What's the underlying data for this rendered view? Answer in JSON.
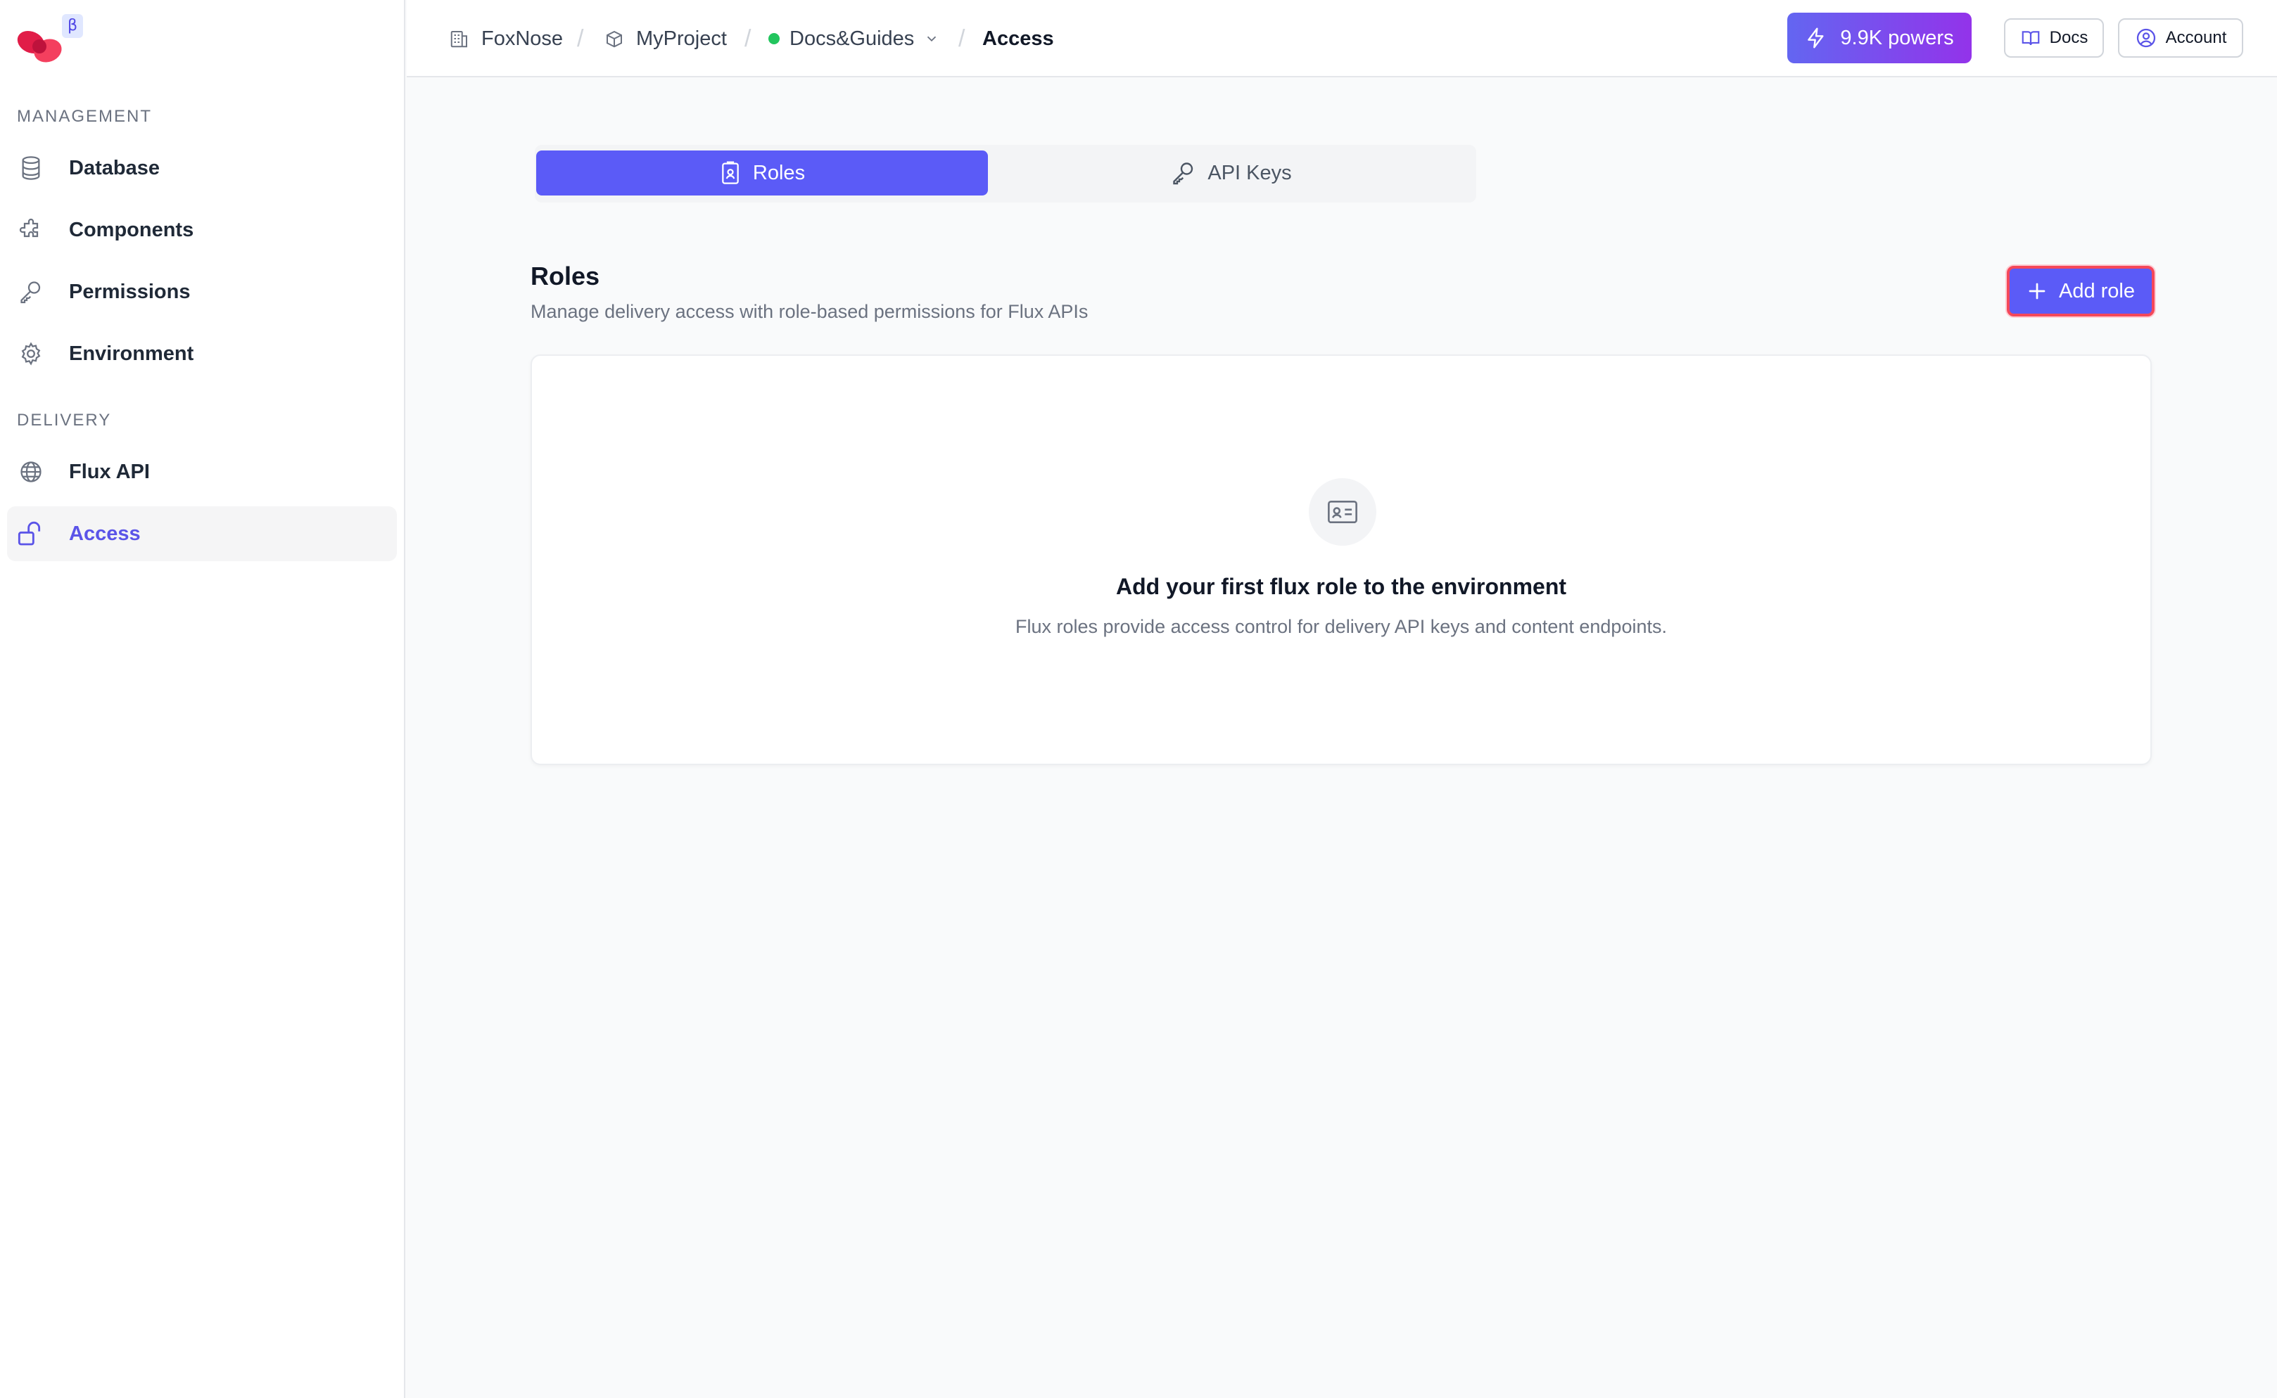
{
  "brand": {
    "beta_badge": "β"
  },
  "sidebar": {
    "management_label": "MANAGEMENT",
    "delivery_label": "DELIVERY",
    "items": [
      {
        "label": "Database",
        "icon": "database-icon"
      },
      {
        "label": "Components",
        "icon": "puzzle-icon"
      },
      {
        "label": "Permissions",
        "icon": "key-icon"
      },
      {
        "label": "Environment",
        "icon": "gear-icon"
      },
      {
        "label": "Flux API",
        "icon": "globe-icon"
      },
      {
        "label": "Access",
        "icon": "unlock-icon",
        "active": true
      }
    ]
  },
  "header": {
    "breadcrumbs": [
      {
        "label": "FoxNose",
        "icon": "building-icon"
      },
      {
        "label": "MyProject",
        "icon": "box-icon"
      },
      {
        "label": "Docs&Guides",
        "icon": "status-dot",
        "status_color": "#22c55e"
      },
      {
        "label": "Access",
        "current": true
      }
    ],
    "powers_label": "9.9K powers",
    "docs_label": "Docs",
    "account_label": "Account"
  },
  "tabs": [
    {
      "label": "Roles",
      "icon": "id-badge-icon",
      "active": true
    },
    {
      "label": "API Keys",
      "icon": "key-icon",
      "active": false
    }
  ],
  "roles": {
    "title": "Roles",
    "description": "Manage delivery access with role-based permissions for Flux APIs",
    "add_label": "Add role",
    "empty_title": "Add your first flux role to the environment",
    "empty_description": "Flux roles provide access control for delivery API keys and content endpoints."
  },
  "colors": {
    "accent": "#5b5bf7",
    "active_nav_text": "#5b54e8",
    "highlight_border": "#f4475a"
  }
}
